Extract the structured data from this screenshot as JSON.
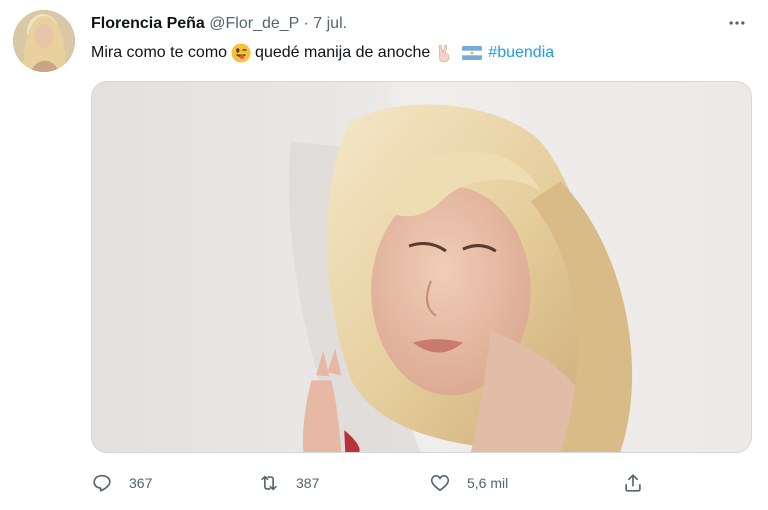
{
  "tweet": {
    "display_name": "Florencia Peña",
    "handle": "@Flor_de_P",
    "separator": " · ",
    "date": "7 jul.",
    "text_part1": "Mira como te como",
    "text_part2": "quedé manija de anoche",
    "hashtag": "#buendia",
    "emojis": [
      "winking-face-with-tongue-emoji",
      "victory-hand-emoji",
      "argentina-flag-emoji"
    ]
  },
  "actions": {
    "replies": "367",
    "retweets": "387",
    "likes": "5,6 mil"
  },
  "colors": {
    "text": "#0f1419",
    "muted": "#536471",
    "link": "#1d9bf0",
    "border": "#cfd9de"
  },
  "icons": {
    "more": "more-horizontal-icon",
    "reply": "reply-icon",
    "retweet": "retweet-icon",
    "like": "heart-icon",
    "share": "share-icon"
  }
}
